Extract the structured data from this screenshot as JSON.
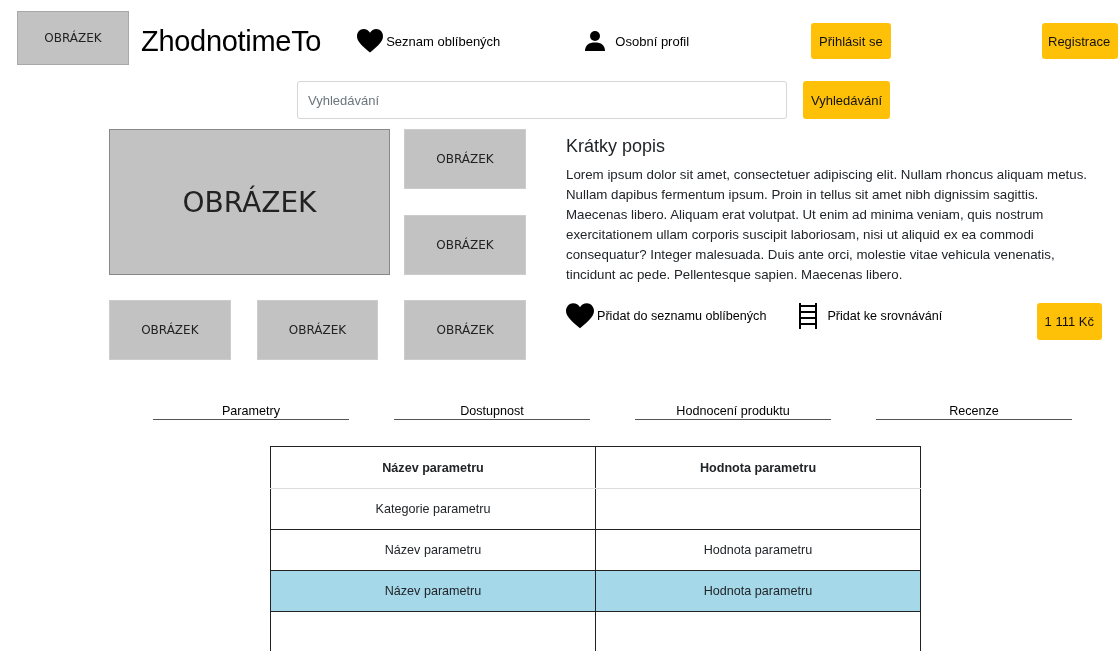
{
  "header": {
    "logo": "OBRÁZEK",
    "brand": "ZhodnotimeTo",
    "favorites": "Seznam oblíbených",
    "profile": "Osobní profil",
    "login": "Přihlásit se",
    "register": "Registrace"
  },
  "search": {
    "placeholder": "Vyhledávání",
    "button": "Vyhledávání"
  },
  "gallery": {
    "main": "OBRÁZEK",
    "side": [
      "OBRÁZEK",
      "OBRÁZEK"
    ],
    "bottom": [
      "OBRÁZEK",
      "OBRÁZEK",
      "OBRÁZEK"
    ]
  },
  "product": {
    "heading": "Krátky popis",
    "description": "Lorem ipsum dolor sit amet, consectetuer adipiscing elit. Nullam rhoncus aliquam metus. Nullam dapibus fermentum ipsum. Proin in tellus sit amet nibh dignissim sagittis. Maecenas libero. Aliquam erat volutpat. Ut enim ad minima veniam, quis nostrum exercitationem ullam corporis suscipit laboriosam, nisi ut aliquid ex ea commodi consequatur? Integer malesuada. Duis ante orci, molestie vitae vehicula venenatis, tincidunt ac pede. Pellentesque sapien. Maecenas libero.",
    "add_favorite": "Přidat do seznamu oblíbených",
    "add_compare": "Přidat ke srovnávání",
    "price": "1 111 Kč"
  },
  "tabs": [
    {
      "label": "Parametry"
    },
    {
      "label": "Dostupnost"
    },
    {
      "label": "Hodnocení produktu"
    },
    {
      "label": "Recenze"
    }
  ],
  "table": {
    "columns": [
      "Název parametru",
      "Hodnota parametru"
    ],
    "rows": [
      {
        "cells": [
          "Kategorie parametru"
        ],
        "selected": false
      },
      {
        "cells": [
          "Název parametru",
          "Hodnota parametru"
        ],
        "selected": false
      },
      {
        "cells": [
          "Název parametru",
          "Hodnota parametru"
        ],
        "selected": true
      },
      {
        "cells": [],
        "selected": false
      }
    ]
  }
}
